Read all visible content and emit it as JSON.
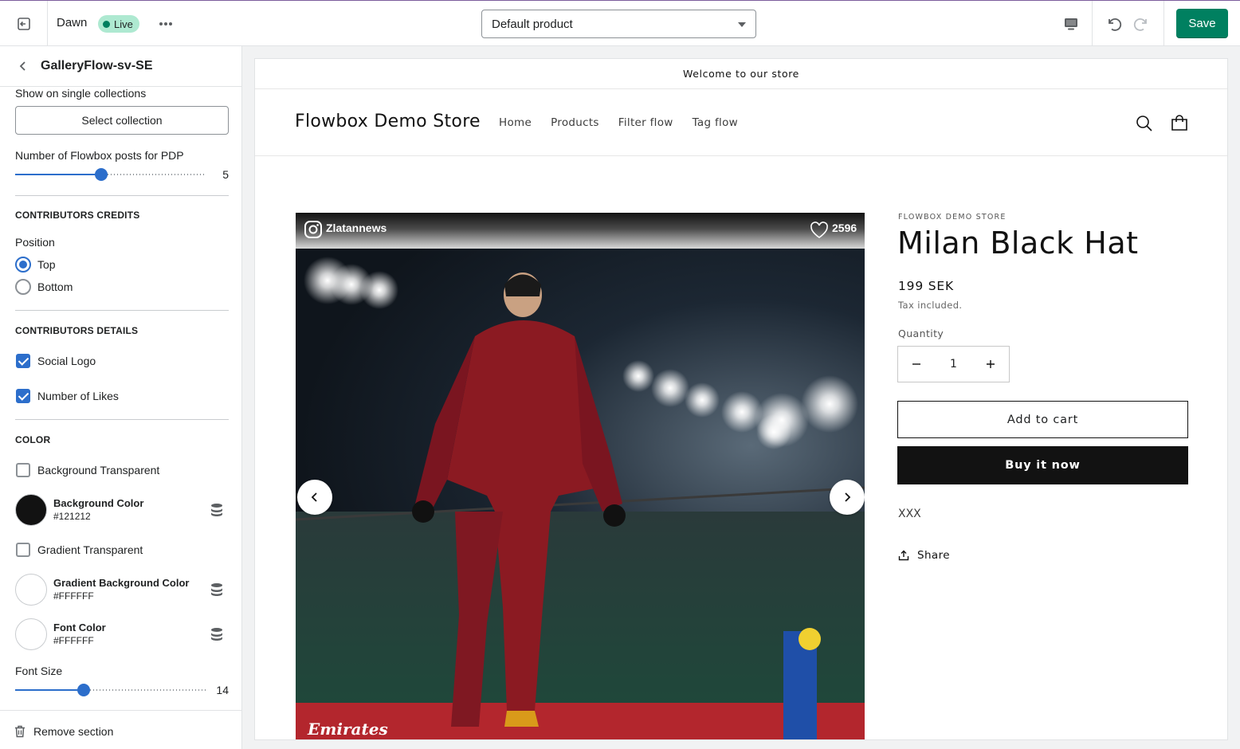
{
  "topbar": {
    "theme_name": "Dawn",
    "live_label": "Live",
    "template_select": "Default product",
    "save_label": "Save"
  },
  "sidebar": {
    "title": "GalleryFlow-sv-SE",
    "show_on_label": "Show on single collections",
    "select_collection_label": "Select collection",
    "posts_label": "Number of Flowbox posts for PDP",
    "posts_value": "5",
    "posts_fraction": 0.45,
    "credits_heading": "CONTRIBUTORS CREDITS",
    "position_label": "Position",
    "position_options": [
      "Top",
      "Bottom"
    ],
    "position_selected": "Top",
    "details_heading": "CONTRIBUTORS DETAILS",
    "social_logo_label": "Social Logo",
    "likes_label": "Number of Likes",
    "color_heading": "COLOR",
    "bg_transparent_label": "Background Transparent",
    "bg_color_name": "Background Color",
    "bg_color_hex": "#121212",
    "gradient_transparent_label": "Gradient Transparent",
    "gradient_color_name": "Gradient Background Color",
    "gradient_color_hex": "#FFFFFF",
    "font_color_name": "Font Color",
    "font_color_hex": "#FFFFFF",
    "font_size_label": "Font Size",
    "font_size_value": "14",
    "font_size_fraction": 0.36,
    "remove_label": "Remove section"
  },
  "store": {
    "announcement": "Welcome to our store",
    "name": "Flowbox Demo Store",
    "nav": [
      "Home",
      "Products",
      "Filter flow",
      "Tag flow"
    ]
  },
  "gallery": {
    "username": "Zlatannews",
    "likes": "2596"
  },
  "product": {
    "vendor": "FLOWBOX DEMO STORE",
    "title": "Milan Black Hat",
    "price": "199 SEK",
    "tax_note": "Tax included.",
    "quantity_label": "Quantity",
    "quantity": "1",
    "add_to_cart": "Add to cart",
    "buy_now": "Buy it now",
    "description": "XXX",
    "share": "Share"
  },
  "colors": {
    "accent": "#2c6ecb",
    "save": "#008060",
    "live_badge": "#aee9d1"
  }
}
